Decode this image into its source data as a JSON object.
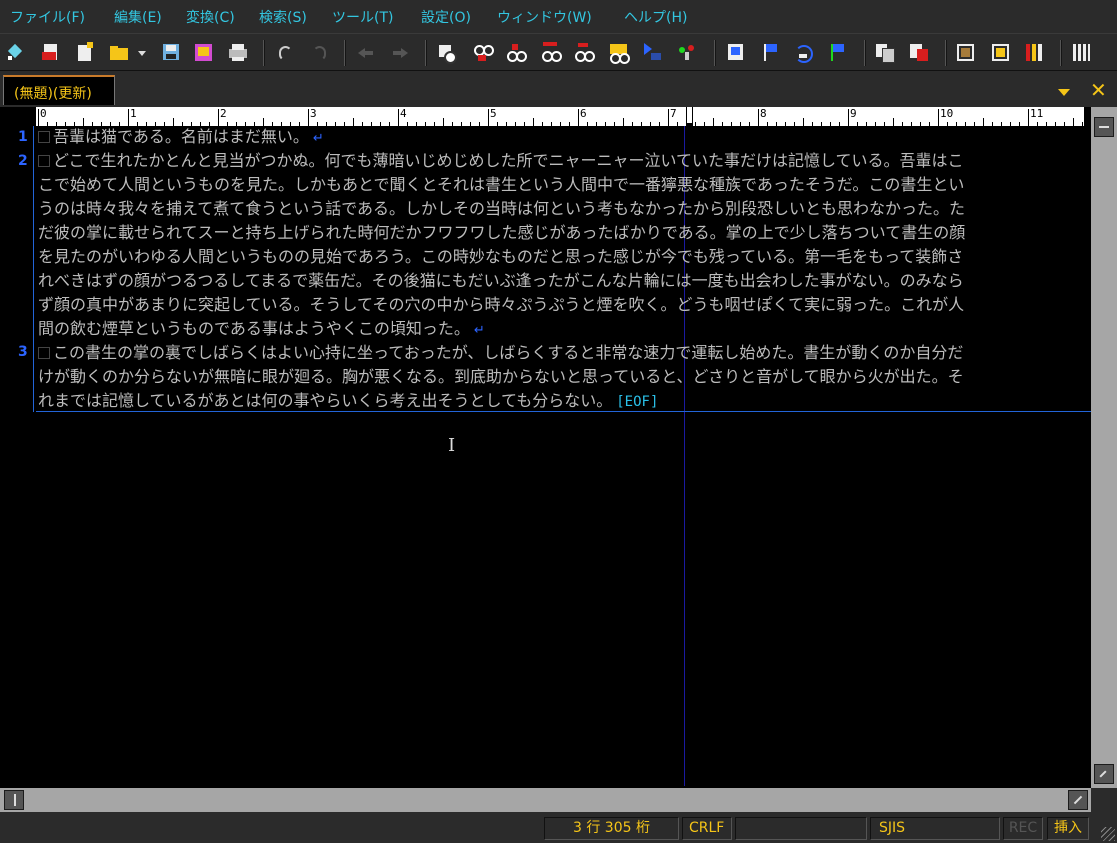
{
  "menu": [
    "ファイル(F)",
    "編集(E)",
    "変換(C)",
    "検索(S)",
    "ツール(T)",
    "設定(O)",
    "ウィンドウ(W)",
    "ヘルプ(H)"
  ],
  "tab": {
    "title": "(無題)(更新)"
  },
  "ruler": {
    "numbers": [
      "0",
      "1",
      "2",
      "3",
      "4",
      "5",
      "6",
      "7",
      "8",
      "9",
      "10",
      "11"
    ]
  },
  "editor": {
    "line_numbers": [
      "1",
      "2",
      "3"
    ],
    "lines": [
      "吾輩は猫である。名前はまだ無い。",
      "どこで生れたかとんと見当がつかぬ。何でも薄暗いじめじめした所でニャーニャー泣いていた事だけは記憶している。吾輩はこ",
      "こで始めて人間というものを見た。しかもあとで聞くとそれは書生という人間中で一番獰悪な種族であったそうだ。この書生とい",
      "うのは時々我々を捕えて煮て食うという話である。しかしその当時は何という考もなかったから別段恐しいとも思わなかった。た",
      "だ彼の掌に載せられてスーと持ち上げられた時何だかフワフワした感じがあったばかりである。掌の上で少し落ちついて書生の顔",
      "を見たのがいわゆる人間というものの見始であろう。この時妙なものだと思った感じが今でも残っている。第一毛をもって装飾さ",
      "れべきはずの顔がつるつるしてまるで薬缶だ。その後猫にもだいぶ逢ったがこんな片輪には一度も出会わした事がない。のみなら",
      "ず顔の真中があまりに突起している。そうしてその穴の中から時々ぷうぷうと煙を吹く。どうも咽せぽくて実に弱った。これが人",
      "間の飲む煙草というものである事はようやくこの頃知った。",
      "この書生の掌の裏でしばらくはよい心持に坐っておったが、しばらくすると非常な速力で運転し始めた。書生が動くのか自分だ",
      "けが動くのか分らないが無暗に眼が廻る。胸が悪くなる。到底助からないと思っていると、どさりと音がして眼から火が出た。そ",
      "れまでは記憶しているがあとは何の事やらいくら考え出そうとしても分らない。"
    ],
    "eof": "[EOF]"
  },
  "status": {
    "position": "3 行 305 桁",
    "newline": "CRLF",
    "encoding": "SJIS",
    "rec": "REC",
    "mode": "挿入"
  },
  "colors": {
    "menu_text": "#33c6e0",
    "tab_text": "#f5c518",
    "line_number": "#2c64ff",
    "text": "#bcbcbc",
    "eof": "#2ac0e8",
    "status_text": "#f5c518"
  },
  "toolbar_icons": [
    "pin-icon",
    "new-close-icon",
    "new-file-icon",
    "open-folder-icon",
    "open-dropdown-icon",
    "save-icon",
    "save-all-icon",
    "print-icon",
    "undo-icon",
    "redo-icon",
    "back-icon",
    "forward-icon",
    "find-icon",
    "find-up-icon",
    "find-down-icon",
    "find-prev-icon",
    "find-next-icon",
    "mark-icon",
    "goto-line-icon",
    "goto-pair-icon",
    "bookmark-icon",
    "bookmark-set-icon",
    "bookmark-jump-icon",
    "bookmark-clear-icon",
    "copy-icon",
    "paste-icon",
    "tool1-icon",
    "tool2-icon",
    "tool3-icon",
    "grid-icon"
  ]
}
